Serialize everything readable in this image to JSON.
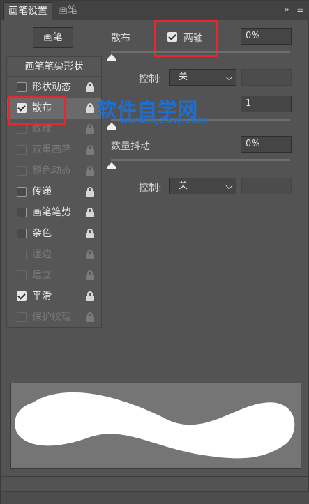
{
  "tabs": [
    {
      "label": "画笔设置"
    },
    {
      "label": "画笔"
    }
  ],
  "header_icons": {
    "expand": "»",
    "menu": "≡"
  },
  "brush_button": {
    "label": "画笔"
  },
  "left_panel": {
    "header": "画笔笔尖形状",
    "items": [
      {
        "label": "形状动态",
        "checked": false,
        "enabled": true
      },
      {
        "label": "散布",
        "checked": true,
        "enabled": true,
        "selected": true
      },
      {
        "label": "纹理",
        "checked": false,
        "enabled": false
      },
      {
        "label": "双重画笔",
        "checked": false,
        "enabled": false
      },
      {
        "label": "颜色动态",
        "checked": false,
        "enabled": false
      },
      {
        "label": "传递",
        "checked": false,
        "enabled": true
      },
      {
        "label": "画笔笔势",
        "checked": false,
        "enabled": true
      },
      {
        "label": "杂色",
        "checked": false,
        "enabled": true
      },
      {
        "label": "湿边",
        "checked": false,
        "enabled": false
      },
      {
        "label": "建立",
        "checked": false,
        "enabled": false
      },
      {
        "label": "平滑",
        "checked": true,
        "enabled": true
      },
      {
        "label": "保护纹理",
        "checked": false,
        "enabled": false
      }
    ]
  },
  "scatter": {
    "label": "散布",
    "both_axes_label": "两轴",
    "both_axes_checked": true,
    "value": "0%",
    "level_percent": 0,
    "control_label": "控制:",
    "control_value": "关"
  },
  "count": {
    "value": "1",
    "level_percent": 0
  },
  "count_jitter": {
    "label": "数量抖动",
    "value": "0%",
    "level_percent": 0,
    "control_label": "控制:",
    "control_value": "关"
  },
  "watermark": {
    "main": "软件自学网",
    "sub": "WWW.RJZXW.COM"
  },
  "colors": {
    "panel_bg": "#535353",
    "highlight": "#e8262d",
    "watermark": "#1f6fd1",
    "preview_bg": "#757575"
  }
}
